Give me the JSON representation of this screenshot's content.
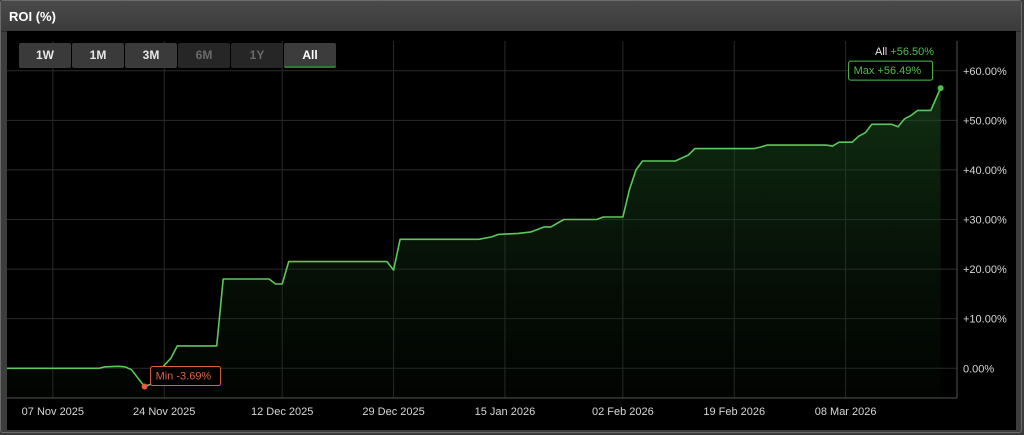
{
  "panel": {
    "title": "ROI (%)"
  },
  "range_buttons": [
    {
      "label": "1W",
      "state": "normal"
    },
    {
      "label": "1M",
      "state": "normal"
    },
    {
      "label": "3M",
      "state": "normal"
    },
    {
      "label": "6M",
      "state": "disabled"
    },
    {
      "label": "1Y",
      "state": "disabled"
    },
    {
      "label": "All",
      "state": "active"
    }
  ],
  "legend": {
    "label": "All",
    "value": "+56.50%"
  },
  "annotations": {
    "max_label": "Max +56.49%",
    "min_label": "Min -3.69%"
  },
  "colors": {
    "line": "#5cc85c",
    "min": "#e0603a",
    "max": "#4cbf4c",
    "grid": "#2a2a2a",
    "text": "#d6d6d6"
  },
  "chart_data": {
    "type": "area",
    "title": "ROI (%)",
    "xlabel": "",
    "ylabel": "",
    "ylim": [
      -6,
      66
    ],
    "xlim": [
      "2025-10-31",
      "2026-03-25"
    ],
    "y_ticks": [
      0,
      10,
      20,
      30,
      40,
      50,
      60
    ],
    "y_tick_labels": [
      "0.00%",
      "+10.00%",
      "+20.00%",
      "+30.00%",
      "+40.00%",
      "+50.00%",
      "+60.00%"
    ],
    "x_ticks": [
      "2025-11-07",
      "2025-11-24",
      "2025-12-12",
      "2025-12-29",
      "2026-01-15",
      "2026-02-02",
      "2026-02-19",
      "2026-03-08"
    ],
    "x_tick_labels": [
      "07 Nov 2025",
      "24 Nov 2025",
      "12 Dec 2025",
      "29 Dec 2025",
      "15 Jan 2026",
      "02 Feb 2026",
      "19 Feb 2026",
      "08 Mar 2026"
    ],
    "grid": true,
    "legend": "top-right",
    "series": [
      {
        "name": "All",
        "points": [
          [
            "2025-10-31",
            0.0
          ],
          [
            "2025-11-10",
            0.0
          ],
          [
            "2025-11-14",
            0.0
          ],
          [
            "2025-11-15",
            0.3
          ],
          [
            "2025-11-17",
            0.4
          ],
          [
            "2025-11-18",
            0.3
          ],
          [
            "2025-11-19",
            -0.3
          ],
          [
            "2025-11-20",
            -2.0
          ],
          [
            "2025-11-21",
            -3.69
          ],
          [
            "2025-11-22",
            -3.2
          ],
          [
            "2025-11-23",
            -0.8
          ],
          [
            "2025-11-25",
            2.0
          ],
          [
            "2025-11-26",
            4.5
          ],
          [
            "2025-12-02",
            4.5
          ],
          [
            "2025-12-03",
            18.0
          ],
          [
            "2025-12-10",
            18.0
          ],
          [
            "2025-12-11",
            17.0
          ],
          [
            "2025-12-12",
            17.0
          ],
          [
            "2025-12-13",
            21.5
          ],
          [
            "2025-12-28",
            21.5
          ],
          [
            "2025-12-29",
            19.8
          ],
          [
            "2025-12-30",
            26.0
          ],
          [
            "2026-01-11",
            26.0
          ],
          [
            "2026-01-13",
            26.5
          ],
          [
            "2026-01-14",
            27.0
          ],
          [
            "2026-01-17",
            27.2
          ],
          [
            "2026-01-19",
            27.5
          ],
          [
            "2026-01-20",
            28.0
          ],
          [
            "2026-01-21",
            28.5
          ],
          [
            "2026-01-22",
            28.5
          ],
          [
            "2026-01-24",
            30.0
          ],
          [
            "2026-01-29",
            30.0
          ],
          [
            "2026-01-30",
            30.5
          ],
          [
            "2026-02-02",
            30.5
          ],
          [
            "2026-02-03",
            36.0
          ],
          [
            "2026-02-04",
            40.0
          ],
          [
            "2026-02-05",
            41.8
          ],
          [
            "2026-02-10",
            41.8
          ],
          [
            "2026-02-12",
            43.0
          ],
          [
            "2026-02-13",
            44.3
          ],
          [
            "2026-02-22",
            44.3
          ],
          [
            "2026-02-23",
            44.6
          ],
          [
            "2026-02-24",
            45.0
          ],
          [
            "2026-03-05",
            45.0
          ],
          [
            "2026-03-06",
            44.8
          ],
          [
            "2026-03-07",
            45.6
          ],
          [
            "2026-03-09",
            45.6
          ],
          [
            "2026-03-10",
            46.8
          ],
          [
            "2026-03-11",
            47.5
          ],
          [
            "2026-03-12",
            49.2
          ],
          [
            "2026-03-15",
            49.2
          ],
          [
            "2026-03-16",
            48.7
          ],
          [
            "2026-03-17",
            50.3
          ],
          [
            "2026-03-18",
            51.0
          ],
          [
            "2026-03-19",
            52.0
          ],
          [
            "2026-03-21",
            52.0
          ],
          [
            "2026-03-22",
            55.0
          ],
          [
            "2026-03-22T12",
            56.49
          ]
        ]
      }
    ],
    "annotations": [
      {
        "label": "Max +56.49%",
        "x": "2026-03-22T12",
        "y": 56.49
      },
      {
        "label": "Min -3.69%",
        "x": "2025-11-21",
        "y": -3.69
      }
    ]
  }
}
